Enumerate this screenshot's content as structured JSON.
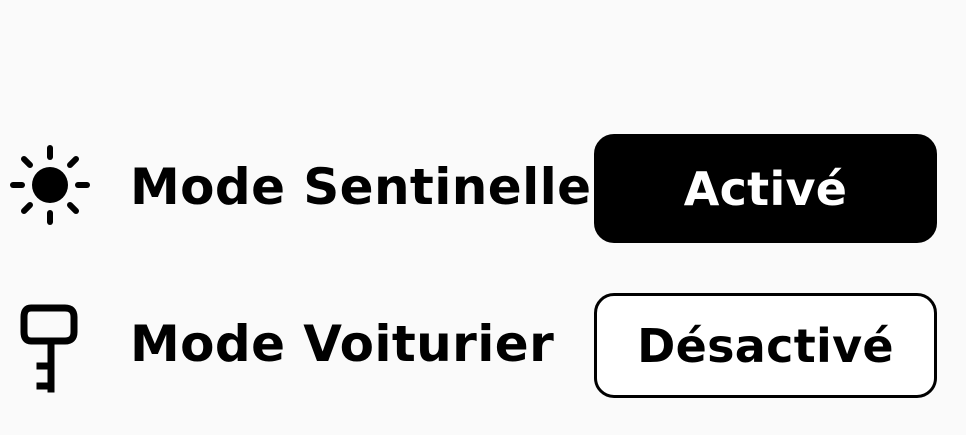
{
  "settings": {
    "rows": [
      {
        "icon": "sun-icon",
        "label": "Mode Sentinelle",
        "status": "Activé",
        "state": "on"
      },
      {
        "icon": "key-icon",
        "label": "Mode Voiturier",
        "status": "Désactivé",
        "state": "off"
      }
    ],
    "colors": {
      "background": "#fafafa",
      "active_button": "#000000",
      "active_text": "#ffffff",
      "inactive_button": "#ffffff",
      "inactive_text": "#000000",
      "outline": "#000000"
    }
  }
}
